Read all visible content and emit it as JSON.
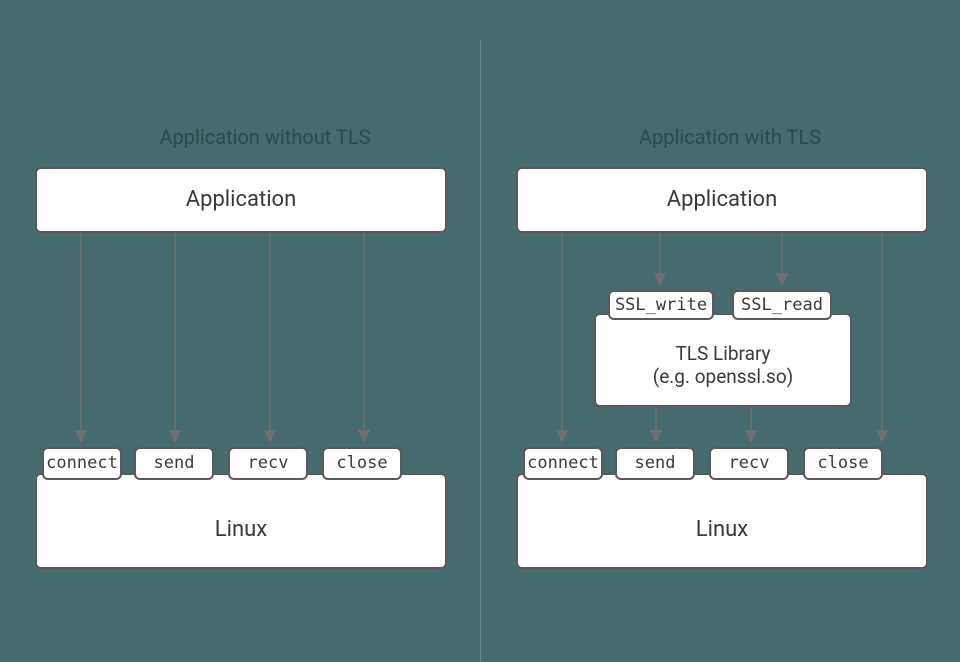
{
  "left": {
    "title": "Application without TLS",
    "application": "Application",
    "os": "Linux",
    "syscalls": [
      "connect",
      "send",
      "recv",
      "close"
    ]
  },
  "right": {
    "title": "Application with TLS",
    "application": "Application",
    "os": "Linux",
    "tls_library_line1": "TLS Library",
    "tls_library_line2": "(e.g. openssl.so)",
    "tls_funcs": [
      "SSL_write",
      "SSL_read"
    ],
    "syscalls": [
      "connect",
      "send",
      "recv",
      "close"
    ]
  },
  "arrow_color": "#6e6e6e"
}
